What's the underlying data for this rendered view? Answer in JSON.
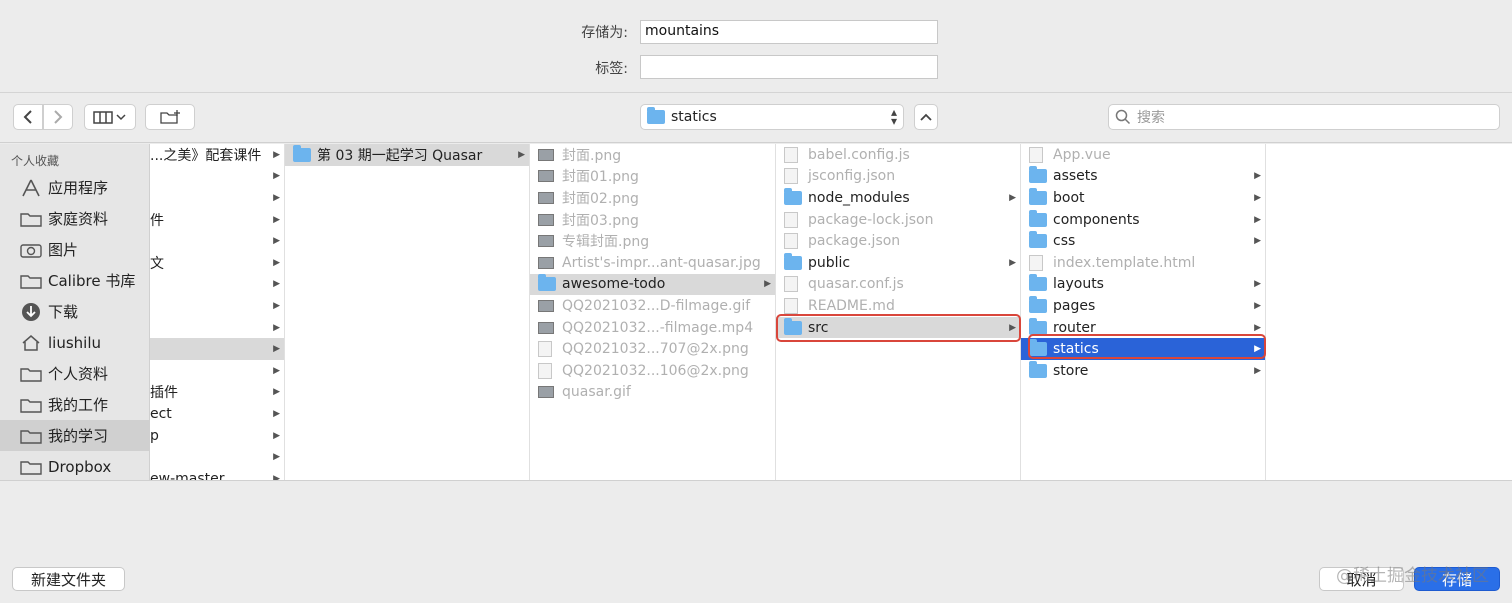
{
  "save_as": {
    "label": "存储为:",
    "value": "mountains"
  },
  "tags": {
    "label": "标签:",
    "value": ""
  },
  "toolbar": {
    "path_label": "statics",
    "search_placeholder": "搜索"
  },
  "sidebar": {
    "heading": "个人收藏",
    "items": [
      {
        "label": "应用程序",
        "icon": "apps-icon"
      },
      {
        "label": "家庭资料",
        "icon": "folder-icon"
      },
      {
        "label": "图片",
        "icon": "camera-icon"
      },
      {
        "label": "Calibre 书库",
        "icon": "folder-icon"
      },
      {
        "label": "下载",
        "icon": "download-icon"
      },
      {
        "label": "liushilu",
        "icon": "home-icon"
      },
      {
        "label": "个人资料",
        "icon": "folder-icon"
      },
      {
        "label": "我的工作",
        "icon": "folder-icon"
      },
      {
        "label": "我的学习",
        "icon": "folder-icon",
        "selected": true
      },
      {
        "label": "Dropbox",
        "icon": "folder-icon"
      }
    ]
  },
  "columns": {
    "col1": [
      {
        "name": "...之美》配套课件",
        "arrow": true
      },
      {
        "name": "",
        "arrow": true
      },
      {
        "name": "",
        "arrow": true
      },
      {
        "name": "件",
        "arrow": true
      },
      {
        "name": "",
        "arrow": true
      },
      {
        "name": "文",
        "arrow": true
      },
      {
        "name": "",
        "arrow": true
      },
      {
        "name": "",
        "arrow": true
      },
      {
        "name": "",
        "arrow": true
      },
      {
        "name": "",
        "arrow": true,
        "highlight": true
      },
      {
        "name": "",
        "arrow": true
      },
      {
        "name": "插件",
        "arrow": true
      },
      {
        "name": "ect",
        "arrow": true
      },
      {
        "name": "p",
        "arrow": true
      },
      {
        "name": "",
        "arrow": true
      },
      {
        "name": "ew-master",
        "arrow": true
      }
    ],
    "col2": [
      {
        "name": "第 03 期一起学习 Quasar",
        "type": "folder",
        "arrow": true,
        "highlight": true
      }
    ],
    "col3": [
      {
        "name": "封面.png",
        "type": "image",
        "dim": true
      },
      {
        "name": "封面01.png",
        "type": "image",
        "dim": true
      },
      {
        "name": "封面02.png",
        "type": "image",
        "dim": true
      },
      {
        "name": "封面03.png",
        "type": "image",
        "dim": true
      },
      {
        "name": "专辑封面.png",
        "type": "image",
        "dim": true
      },
      {
        "name": "Artist's-impr...ant-quasar.jpg",
        "type": "image",
        "dim": true
      },
      {
        "name": "awesome-todo",
        "type": "folder",
        "arrow": true,
        "highlight": true
      },
      {
        "name": "QQ2021032...D-filmage.gif",
        "type": "image",
        "dim": true
      },
      {
        "name": "QQ2021032...-filmage.mp4",
        "type": "image",
        "dim": true
      },
      {
        "name": "QQ2021032...707@2x.png",
        "type": "file",
        "dim": true
      },
      {
        "name": "QQ2021032...106@2x.png",
        "type": "file",
        "dim": true
      },
      {
        "name": "quasar.gif",
        "type": "image",
        "dim": true
      }
    ],
    "col4": [
      {
        "name": "babel.config.js",
        "type": "file",
        "dim": true
      },
      {
        "name": "jsconfig.json",
        "type": "file",
        "dim": true
      },
      {
        "name": "node_modules",
        "type": "folder",
        "arrow": true
      },
      {
        "name": "package-lock.json",
        "type": "file",
        "dim": true
      },
      {
        "name": "package.json",
        "type": "file",
        "dim": true
      },
      {
        "name": "public",
        "type": "folder",
        "arrow": true
      },
      {
        "name": "quasar.conf.js",
        "type": "file",
        "dim": true
      },
      {
        "name": "README.md",
        "type": "file",
        "dim": true
      },
      {
        "name": "src",
        "type": "folder",
        "arrow": true,
        "highlight": true
      }
    ],
    "col5": [
      {
        "name": "App.vue",
        "type": "file",
        "dim": true
      },
      {
        "name": "assets",
        "type": "folder",
        "arrow": true
      },
      {
        "name": "boot",
        "type": "folder",
        "arrow": true
      },
      {
        "name": "components",
        "type": "folder",
        "arrow": true
      },
      {
        "name": "css",
        "type": "folder",
        "arrow": true
      },
      {
        "name": "index.template.html",
        "type": "file",
        "dim": true
      },
      {
        "name": "layouts",
        "type": "folder",
        "arrow": true
      },
      {
        "name": "pages",
        "type": "folder",
        "arrow": true
      },
      {
        "name": "router",
        "type": "folder",
        "arrow": true
      },
      {
        "name": "statics",
        "type": "folder",
        "arrow": true,
        "selected": true
      },
      {
        "name": "store",
        "type": "folder",
        "arrow": true
      }
    ]
  },
  "bottom": {
    "new_folder": "新建文件夹",
    "cancel": "取消",
    "save": "存储"
  },
  "watermark": "@稀土掘金技术社区"
}
